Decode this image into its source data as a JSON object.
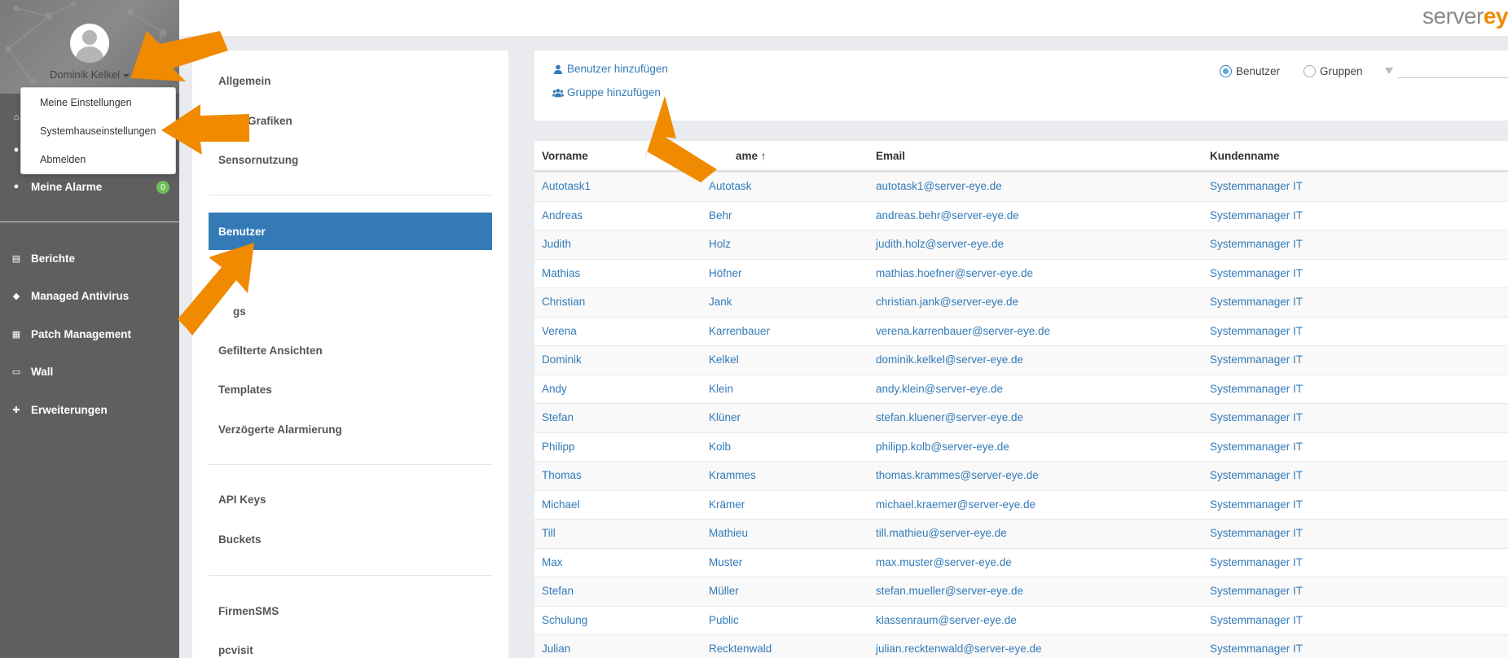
{
  "profile": {
    "name": "Dominik Kelkel"
  },
  "dropdown": {
    "items": [
      "Meine Einstellungen",
      "Systemhauseinstellungen",
      "Abmelden"
    ]
  },
  "sidebar": {
    "alarms_label": "Meine Alarme",
    "alarms_count": "0",
    "items": [
      "Berichte",
      "Managed Antivirus",
      "Patch Management",
      "Wall",
      "Erweiterungen"
    ]
  },
  "logo": {
    "prefix": "server",
    "suffix": "ey"
  },
  "menu": {
    "items": {
      "allgemein": "Allgemein",
      "grafiken": "Grafiken",
      "sensornutzung": "Sensornutzung",
      "benutzer": "Benutzer",
      "item5": "n",
      "item6": "gs",
      "gefilterte": "Gefilterte Ansichten",
      "templates": "Templates",
      "verzoegerte": "Verzögerte Alarmierung",
      "apikeys": "API Keys",
      "buckets": "Buckets",
      "firmensms": "FirmenSMS",
      "pcvisit": "pcvisit"
    }
  },
  "actions": {
    "add_user": "Benutzer hinzufügen",
    "add_group": "Gruppe hinzufügen",
    "radio_users": "Benutzer",
    "radio_groups": "Gruppen"
  },
  "table": {
    "headers": {
      "vorname": "Vorname",
      "nachname": "ame ↑",
      "email": "Email",
      "kunde": "Kundenname"
    },
    "rows": [
      [
        "Autotask1",
        "Autotask",
        "autotask1@server-eye.de",
        "Systemmanager IT"
      ],
      [
        "Andreas",
        "Behr",
        "andreas.behr@server-eye.de",
        "Systemmanager IT"
      ],
      [
        "Judith",
        "Holz",
        "judith.holz@server-eye.de",
        "Systemmanager IT"
      ],
      [
        "Mathias",
        "Höfner",
        "mathias.hoefner@server-eye.de",
        "Systemmanager IT"
      ],
      [
        "Christian",
        "Jank",
        "christian.jank@server-eye.de",
        "Systemmanager IT"
      ],
      [
        "Verena",
        "Karrenbauer",
        "verena.karrenbauer@server-eye.de",
        "Systemmanager IT"
      ],
      [
        "Dominik",
        "Kelkel",
        "dominik.kelkel@server-eye.de",
        "Systemmanager IT"
      ],
      [
        "Andy",
        "Klein",
        "andy.klein@server-eye.de",
        "Systemmanager IT"
      ],
      [
        "Stefan",
        "Klüner",
        "stefan.kluener@server-eye.de",
        "Systemmanager IT"
      ],
      [
        "Philipp",
        "Kolb",
        "philipp.kolb@server-eye.de",
        "Systemmanager IT"
      ],
      [
        "Thomas",
        "Krammes",
        "thomas.krammes@server-eye.de",
        "Systemmanager IT"
      ],
      [
        "Michael",
        "Krämer",
        "michael.kraemer@server-eye.de",
        "Systemmanager IT"
      ],
      [
        "Till",
        "Mathieu",
        "till.mathieu@server-eye.de",
        "Systemmanager IT"
      ],
      [
        "Max",
        "Muster",
        "max.muster@server-eye.de",
        "Systemmanager IT"
      ],
      [
        "Stefan",
        "Müller",
        "stefan.mueller@server-eye.de",
        "Systemmanager IT"
      ],
      [
        "Schulung",
        "Public",
        "klassenraum@server-eye.de",
        "Systemmanager IT"
      ],
      [
        "Julian",
        "Recktenwald",
        "julian.recktenwald@server-eye.de",
        "Systemmanager IT"
      ]
    ]
  },
  "colors": {
    "accent": "#337ab7",
    "arrow": "#f08a00",
    "sidebar": "#5f5f5f",
    "badge": "#6fbf5b"
  },
  "icons": [
    "home-icon",
    "globe-icon",
    "user-icon",
    "book-icon",
    "shield-icon",
    "patch-icon",
    "wall-icon",
    "plus-icon",
    "users-icon",
    "filter-icon"
  ]
}
